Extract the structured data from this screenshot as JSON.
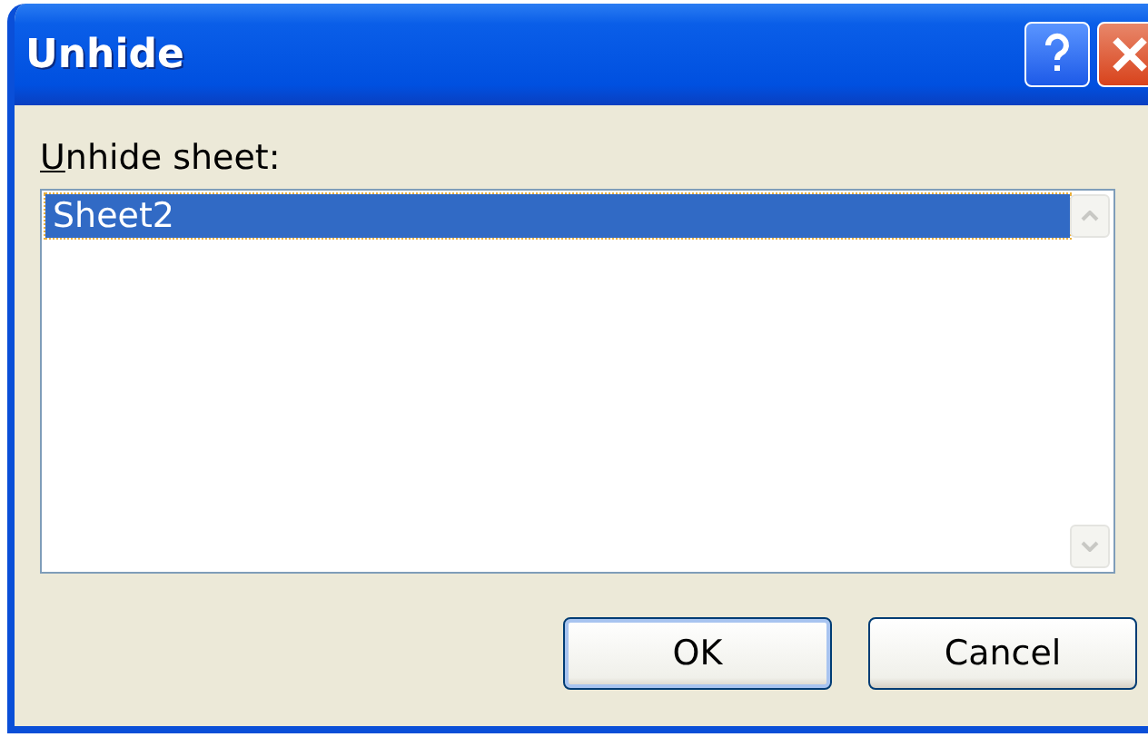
{
  "window": {
    "title": "Unhide"
  },
  "label": {
    "access_key": "U",
    "text": "nhide sheet:"
  },
  "list": {
    "items": [
      {
        "label": "Sheet2",
        "selected": true
      }
    ]
  },
  "buttons": [
    {
      "label": "OK",
      "default": true
    },
    {
      "label": "Cancel",
      "default": false
    }
  ]
}
